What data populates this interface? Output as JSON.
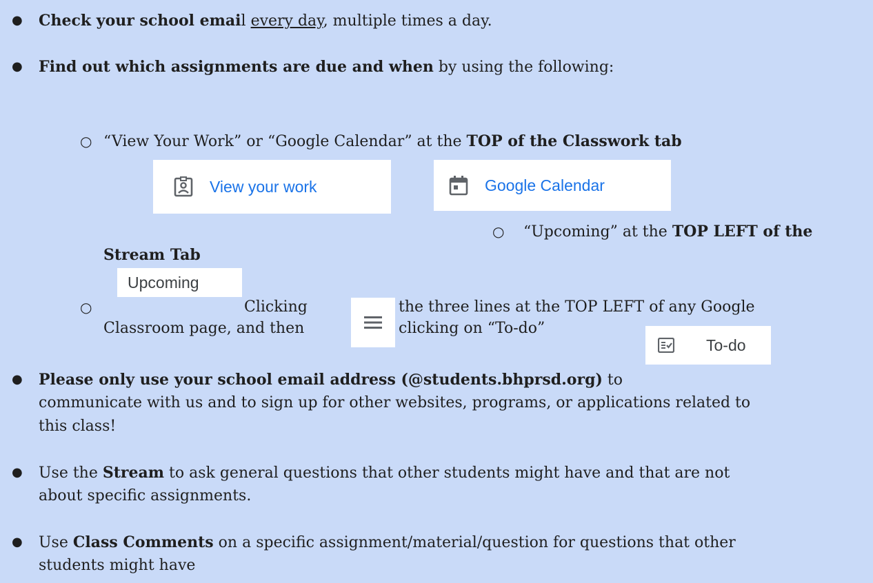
{
  "bullets": {
    "b1": {
      "bold_a": "Check your school emai",
      "plain_a": "l ",
      "underlined": "every day",
      "plain_b": ", multiple times a day."
    },
    "b2": {
      "bold": "Find out which assignments are due and when",
      "plain": " by using the following:"
    },
    "sub1": {
      "plain": "“View Your Work” or “Google Calendar” at the ",
      "bold": "TOP of the Classwork tab"
    },
    "sub2": {
      "plain": "“Upcoming” at the ",
      "bold_a": "TOP LEFT of the",
      "bold_b": "Stream Tab"
    },
    "sub3": {
      "word": "Clicking",
      "rest": "the three lines at the TOP LEFT of any Google",
      "line2_a": "Classroom page, and then",
      "line2_b": "clicking on “To-do”"
    },
    "b3": {
      "bold": "Please only use your school email address (@students.bhprsd.org)",
      "plain_a": " to",
      "line2": "communicate with us and to sign up for other websites, programs, or applications related to",
      "line3": "this class!"
    },
    "b4": {
      "plain_a": "Use the ",
      "bold": "Stream",
      "plain_b": " to ask general questions that other students might have and that are not",
      "line2": "about specific assignments."
    },
    "b5": {
      "plain_a": "Use ",
      "bold": "Class Comments",
      "plain_b": " on a specific assignment/material/question for questions that other",
      "line2": "students might have"
    }
  },
  "chips": {
    "view_work": {
      "label": "View your work",
      "icon": "assignment-ind-icon"
    },
    "calendar": {
      "label": "Google Calendar",
      "icon": "calendar-icon"
    },
    "upcoming": {
      "label": "Upcoming"
    },
    "menu": {
      "icon": "hamburger-menu-icon"
    },
    "todo": {
      "label": "To-do",
      "icon": "todo-checklist-icon"
    }
  },
  "colors": {
    "background": "#c9daf8",
    "google_blue": "#1a73e8",
    "icon_gray": "#5f6368"
  }
}
